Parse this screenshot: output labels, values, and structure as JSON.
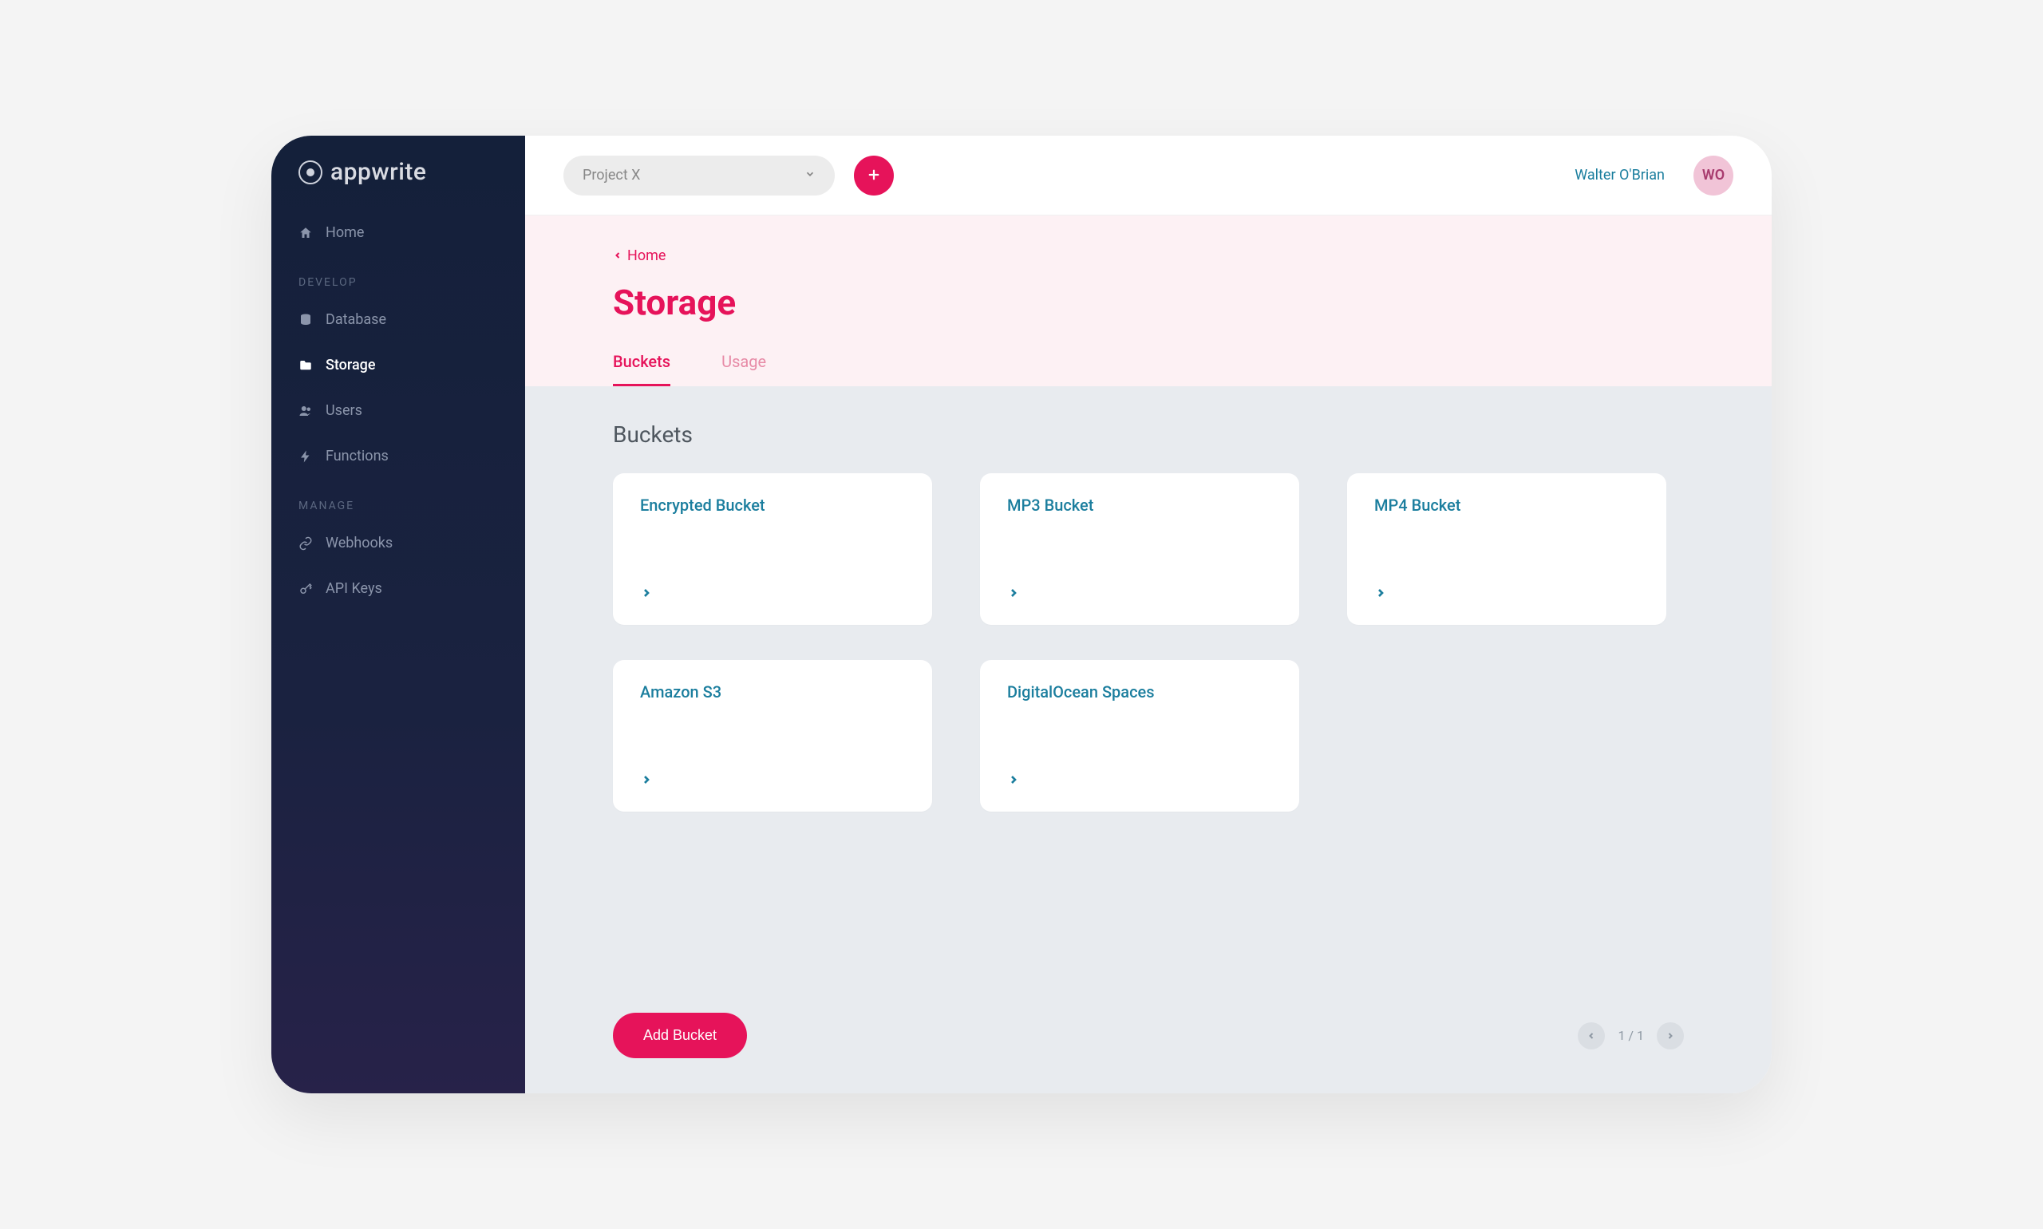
{
  "brand": {
    "name": "appwrite"
  },
  "sidebar": {
    "home_label": "Home",
    "groups": {
      "develop": {
        "title": "DEVELOP",
        "items": [
          {
            "label": "Database"
          },
          {
            "label": "Storage"
          },
          {
            "label": "Users"
          },
          {
            "label": "Functions"
          }
        ]
      },
      "manage": {
        "title": "MANAGE",
        "items": [
          {
            "label": "Webhooks"
          },
          {
            "label": "API Keys"
          }
        ]
      }
    }
  },
  "topbar": {
    "project_selected": "Project X",
    "user_name": "Walter O'Brian",
    "user_initials": "WO"
  },
  "breadcrumb": {
    "label": "Home"
  },
  "page_title": "Storage",
  "tabs": [
    {
      "label": "Buckets",
      "active": true
    },
    {
      "label": "Usage",
      "active": false
    }
  ],
  "section_title": "Buckets",
  "buckets": [
    {
      "name": "Encrypted Bucket"
    },
    {
      "name": "MP3 Bucket"
    },
    {
      "name": "MP4 Bucket"
    },
    {
      "name": "Amazon S3"
    },
    {
      "name": "DigitalOcean Spaces"
    }
  ],
  "actions": {
    "add_bucket_label": "Add Bucket"
  },
  "pager": {
    "label": "1 / 1"
  }
}
